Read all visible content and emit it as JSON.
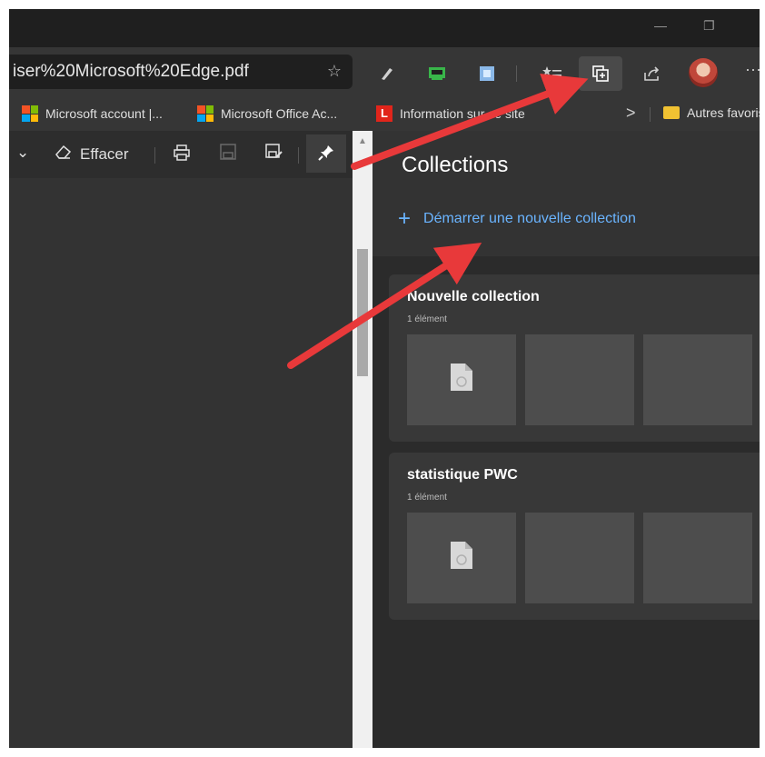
{
  "window": {
    "minimize_label": "—",
    "restore_label": "❐"
  },
  "address_bar": {
    "url": "iser%20Microsoft%20Edge.pdf"
  },
  "toolbar": {
    "more_label": "···"
  },
  "favorites_bar": {
    "items": [
      {
        "label": "Microsoft account |...",
        "icon": "microsoft-logo-icon"
      },
      {
        "label": "Microsoft Office Ac...",
        "icon": "microsoft-logo-icon"
      },
      {
        "label": "Information sur ce site",
        "icon": "l-logo-icon"
      }
    ],
    "overflow_label": ">",
    "other_favorites_label": "Autres favoris"
  },
  "pdf_toolbar": {
    "erase_label": "Effacer"
  },
  "collections": {
    "title": "Collections",
    "new_collection_label": "Démarrer une nouvelle collection",
    "items": [
      {
        "name": "Nouvelle collection",
        "count": "1 élément"
      },
      {
        "name": "statistique PWC",
        "count": "1 élément"
      }
    ]
  },
  "colors": {
    "accent": "#6ab4ff",
    "arrow": "#e8393a"
  }
}
